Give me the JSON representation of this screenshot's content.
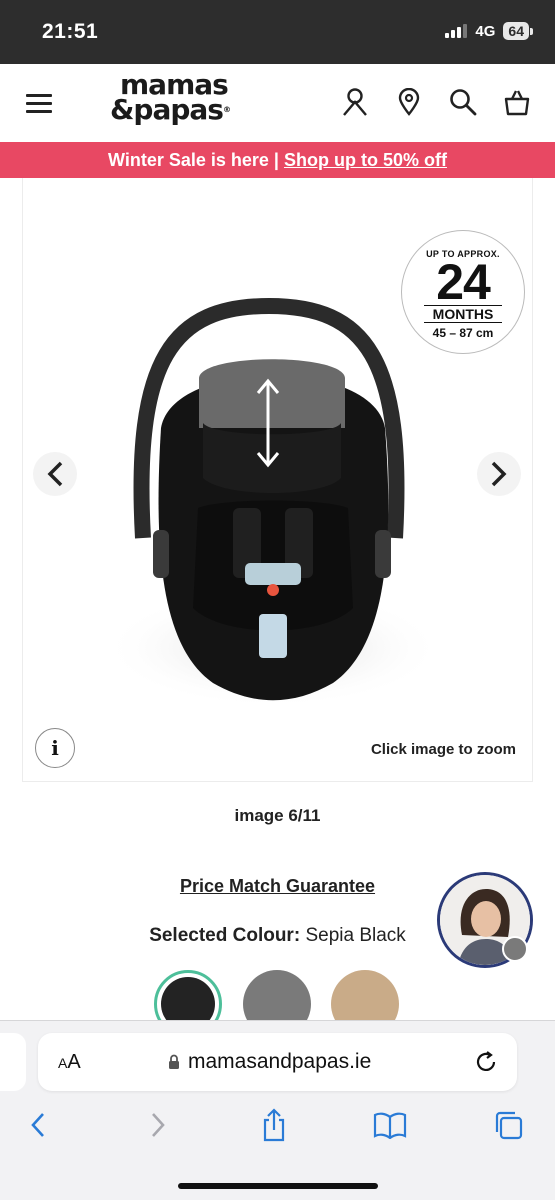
{
  "status_bar": {
    "time": "21:51",
    "network": "4G",
    "battery": "64"
  },
  "header": {
    "logo_line1": "mamas",
    "logo_line2": "&papas",
    "logo_mark": "®",
    "icons": [
      "menu-icon",
      "account-icon",
      "store-locator-icon",
      "search-icon",
      "basket-icon"
    ]
  },
  "promo": {
    "text": "Winter Sale is here | ",
    "link": "Shop up to 50% off",
    "bg_color": "#e84863"
  },
  "gallery": {
    "badge_top": "UP TO APPROX.",
    "badge_number": "24",
    "badge_unit": "MONTHS",
    "badge_range": "45 – 87 cm",
    "zoom_hint": "Click image to zoom",
    "info_icon_label": "i",
    "counter": "image 6/11"
  },
  "product": {
    "price_match": "Price Match Guarantee",
    "selected_colour_label": "Selected Colour:",
    "selected_colour_value": " Sepia Black",
    "swatch_colors": [
      "#232323",
      "#7a7a7a",
      "#c9ab88"
    ],
    "selected_swatch_ring": "#4dbf9a"
  },
  "browser": {
    "aa_label_small": "A",
    "aa_label_large": "A",
    "url": "mamasandpapas.ie"
  }
}
